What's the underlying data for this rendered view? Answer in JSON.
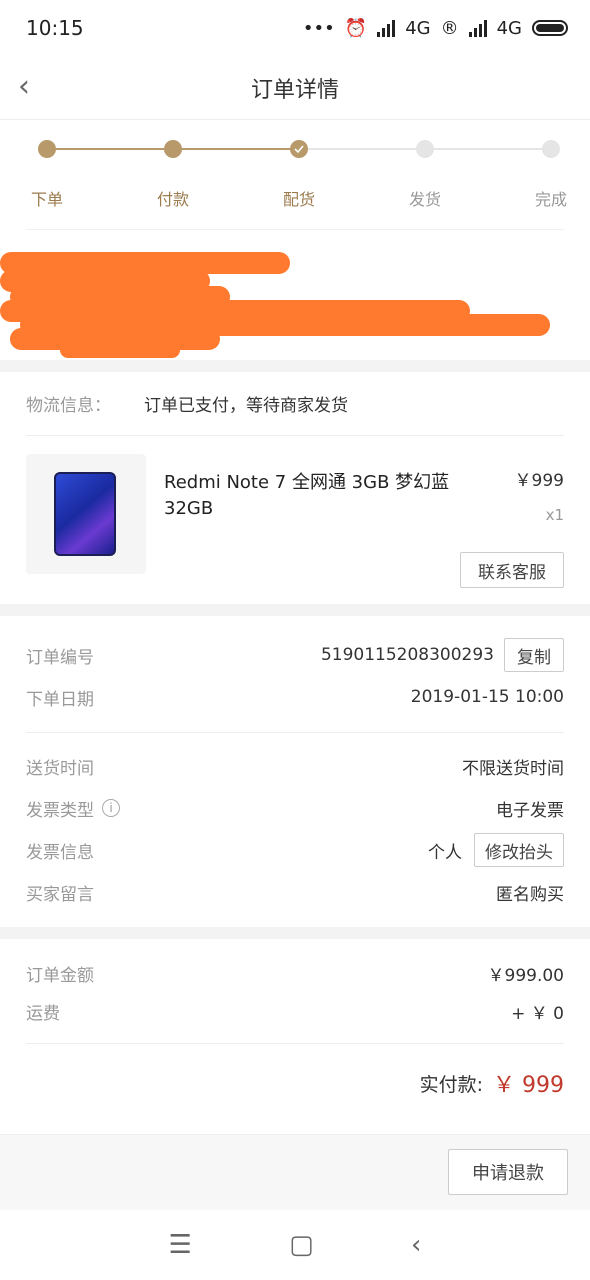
{
  "status_bar": {
    "time": "10:15",
    "network1": "4G",
    "network2": "4G"
  },
  "nav": {
    "title": "订单详情"
  },
  "progress": {
    "steps": [
      "下单",
      "付款",
      "配货",
      "发货",
      "完成"
    ],
    "completed_count": 3
  },
  "logistics": {
    "label": "物流信息：",
    "value": "订单已支付，等待商家发货"
  },
  "product": {
    "name": "Redmi Note 7 全网通 3GB 梦幻蓝 32GB",
    "price": "￥999",
    "quantity": "x1",
    "contact_button": "联系客服"
  },
  "order": {
    "id_label": "订单编号",
    "id_value": "5190115208300293",
    "copy_button": "复制",
    "date_label": "下单日期",
    "date_value": "2019-01-15 10:00",
    "delivery_label": "送货时间",
    "delivery_value": "不限送货时间",
    "invoice_type_label": "发票类型",
    "invoice_type_value": "电子发票",
    "invoice_info_label": "发票信息",
    "invoice_info_value": "个人",
    "edit_button": "修改抬头",
    "message_label": "买家留言",
    "message_value": "匿名购买"
  },
  "amounts": {
    "order_amount_label": "订单金额",
    "order_amount_value": "￥999.00",
    "shipping_label": "运费",
    "shipping_value": "+ ￥ 0",
    "paid_label": "实付款:",
    "paid_value": "￥ 999"
  },
  "actions": {
    "refund_button": "申请退款"
  },
  "colors": {
    "accent": "#b89a6a",
    "price_red": "#c0392b",
    "redaction": "#ff7a2e"
  }
}
